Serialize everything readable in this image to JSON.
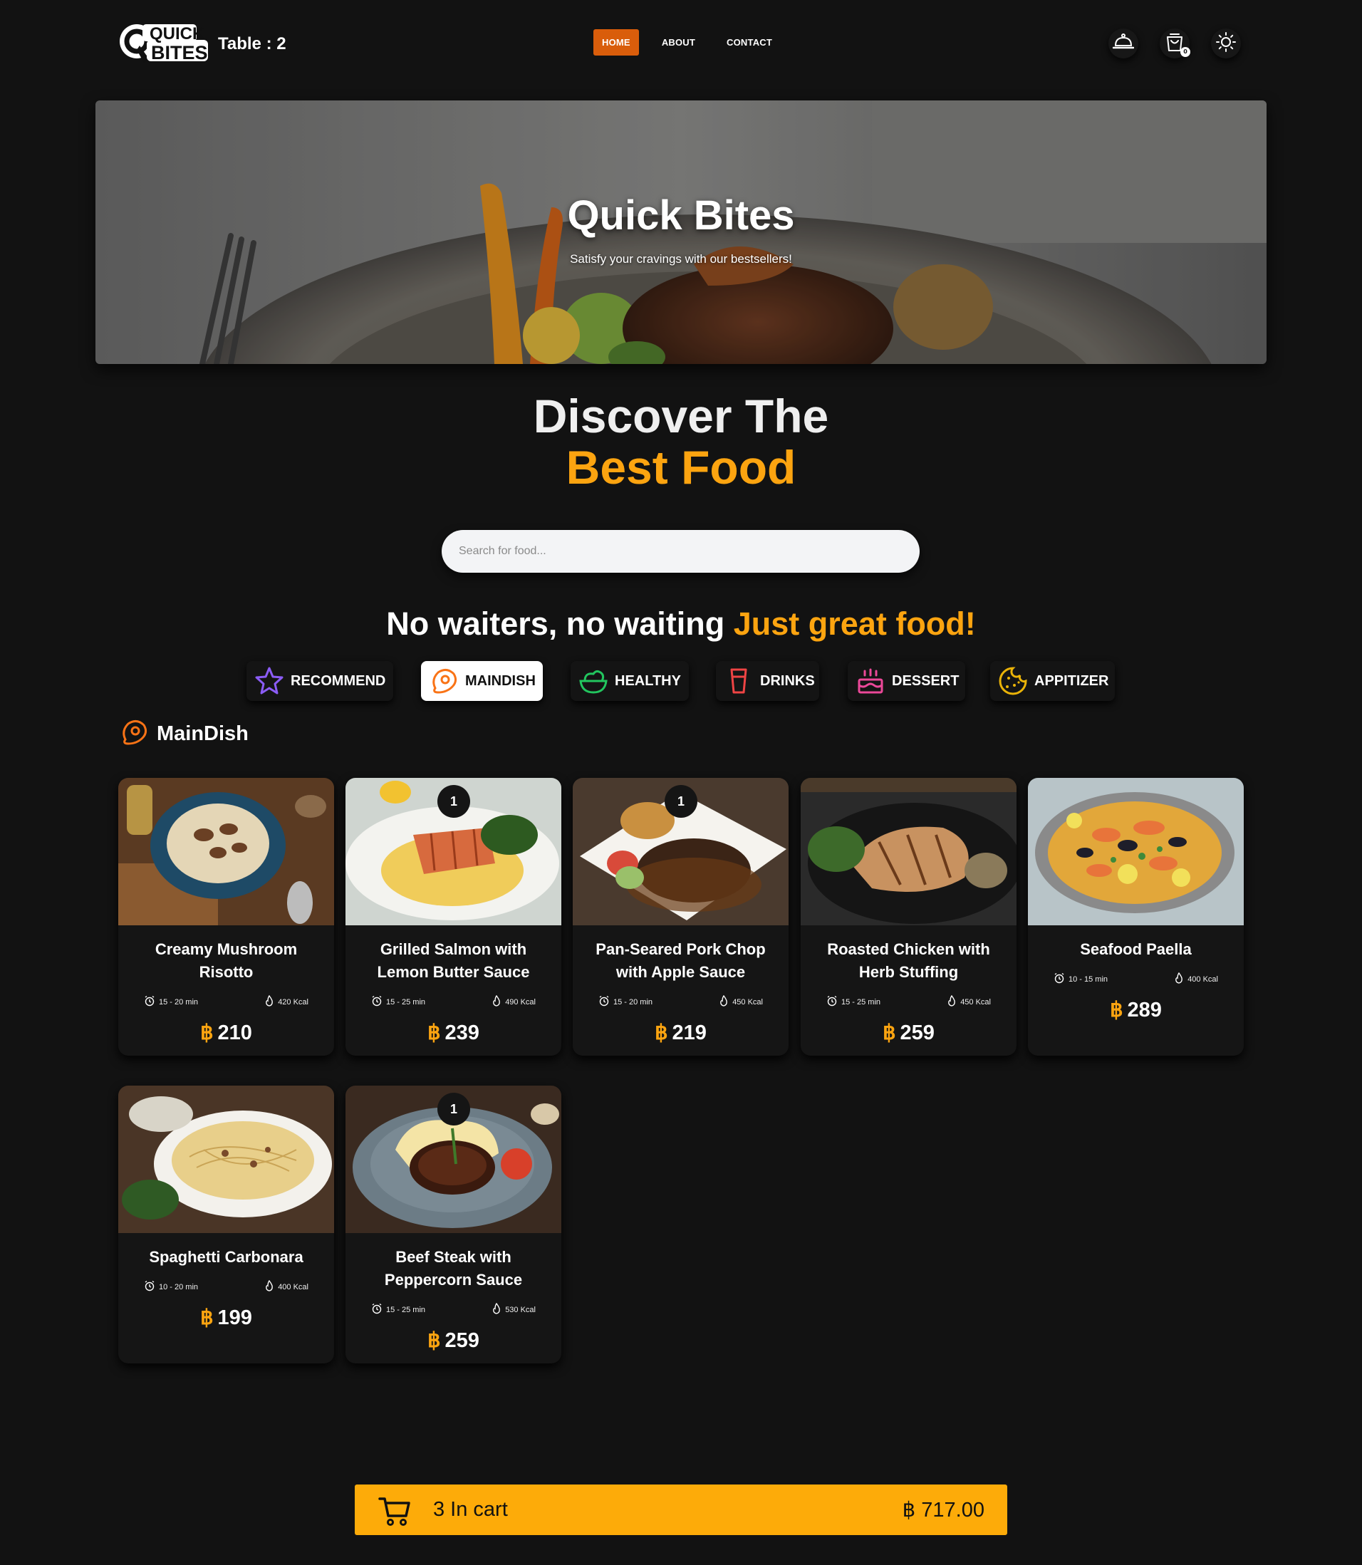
{
  "header": {
    "logo_text_1": "QUICK",
    "logo_text_2": "BITES",
    "table_label": "Table : 2",
    "nav": [
      {
        "label": "HOME",
        "active": true
      },
      {
        "label": "ABOUT",
        "active": false
      },
      {
        "label": "CONTACT",
        "active": false
      }
    ],
    "cart_badge": "0",
    "icons": [
      "bell-service-icon",
      "shopping-bag-icon",
      "sun-icon"
    ]
  },
  "hero": {
    "title": "Quick Bites",
    "subtitle": "Satisfy your cravings with our bestsellers!"
  },
  "discover": {
    "line1": "Discover The",
    "line2": "Best Food"
  },
  "search": {
    "placeholder": "Search for food..."
  },
  "tagline": {
    "text": "No waiters, no waiting ",
    "accent": "Just great food!"
  },
  "categories": [
    {
      "label": "RECOMMEND",
      "icon": "star-icon",
      "color": "#8b5cf6",
      "active": false
    },
    {
      "label": "MAINDISH",
      "icon": "steak-icon",
      "color": "#f97316",
      "active": true
    },
    {
      "label": "HEALTHY",
      "icon": "salad-icon",
      "color": "#22c55e",
      "active": false
    },
    {
      "label": "DRINKS",
      "icon": "cup-icon",
      "color": "#ef4444",
      "active": false
    },
    {
      "label": "DESSERT",
      "icon": "cake-icon",
      "color": "#ec4899",
      "active": false
    },
    {
      "label": "APPITIZER",
      "icon": "cookie-icon",
      "color": "#eab308",
      "active": false
    }
  ],
  "section": {
    "title": "MainDish",
    "icon": "steak-icon"
  },
  "currency": "฿",
  "items": [
    {
      "name": "Creamy Mushroom Risotto",
      "time": "15 - 20 min",
      "kcal": "420 Kcal",
      "price": "210",
      "qty": ""
    },
    {
      "name": "Grilled Salmon with Lemon Butter Sauce",
      "time": "15 - 25 min",
      "kcal": "490 Kcal",
      "price": "239",
      "qty": "1"
    },
    {
      "name": "Pan-Seared Pork Chop with Apple Sauce",
      "time": "15 - 20 min",
      "kcal": "450 Kcal",
      "price": "219",
      "qty": "1"
    },
    {
      "name": "Roasted Chicken with Herb Stuffing",
      "time": "15 - 25 min",
      "kcal": "450 Kcal",
      "price": "259",
      "qty": ""
    },
    {
      "name": "Seafood Paella",
      "time": "10 - 15 min",
      "kcal": "400 Kcal",
      "price": "289",
      "qty": ""
    },
    {
      "name": "Spaghetti Carbonara",
      "time": "10 - 20 min",
      "kcal": "400 Kcal",
      "price": "199",
      "qty": ""
    },
    {
      "name": "Beef Steak with Peppercorn Sauce",
      "time": "15 - 25 min",
      "kcal": "530 Kcal",
      "price": "259",
      "qty": "1"
    }
  ],
  "cart": {
    "count_label": "3 In cart",
    "total_label": "฿ 717.00"
  },
  "colors": {
    "accent": "#fca410",
    "nav_active": "#d95d0b",
    "background": "#121212",
    "card": "#151515"
  }
}
